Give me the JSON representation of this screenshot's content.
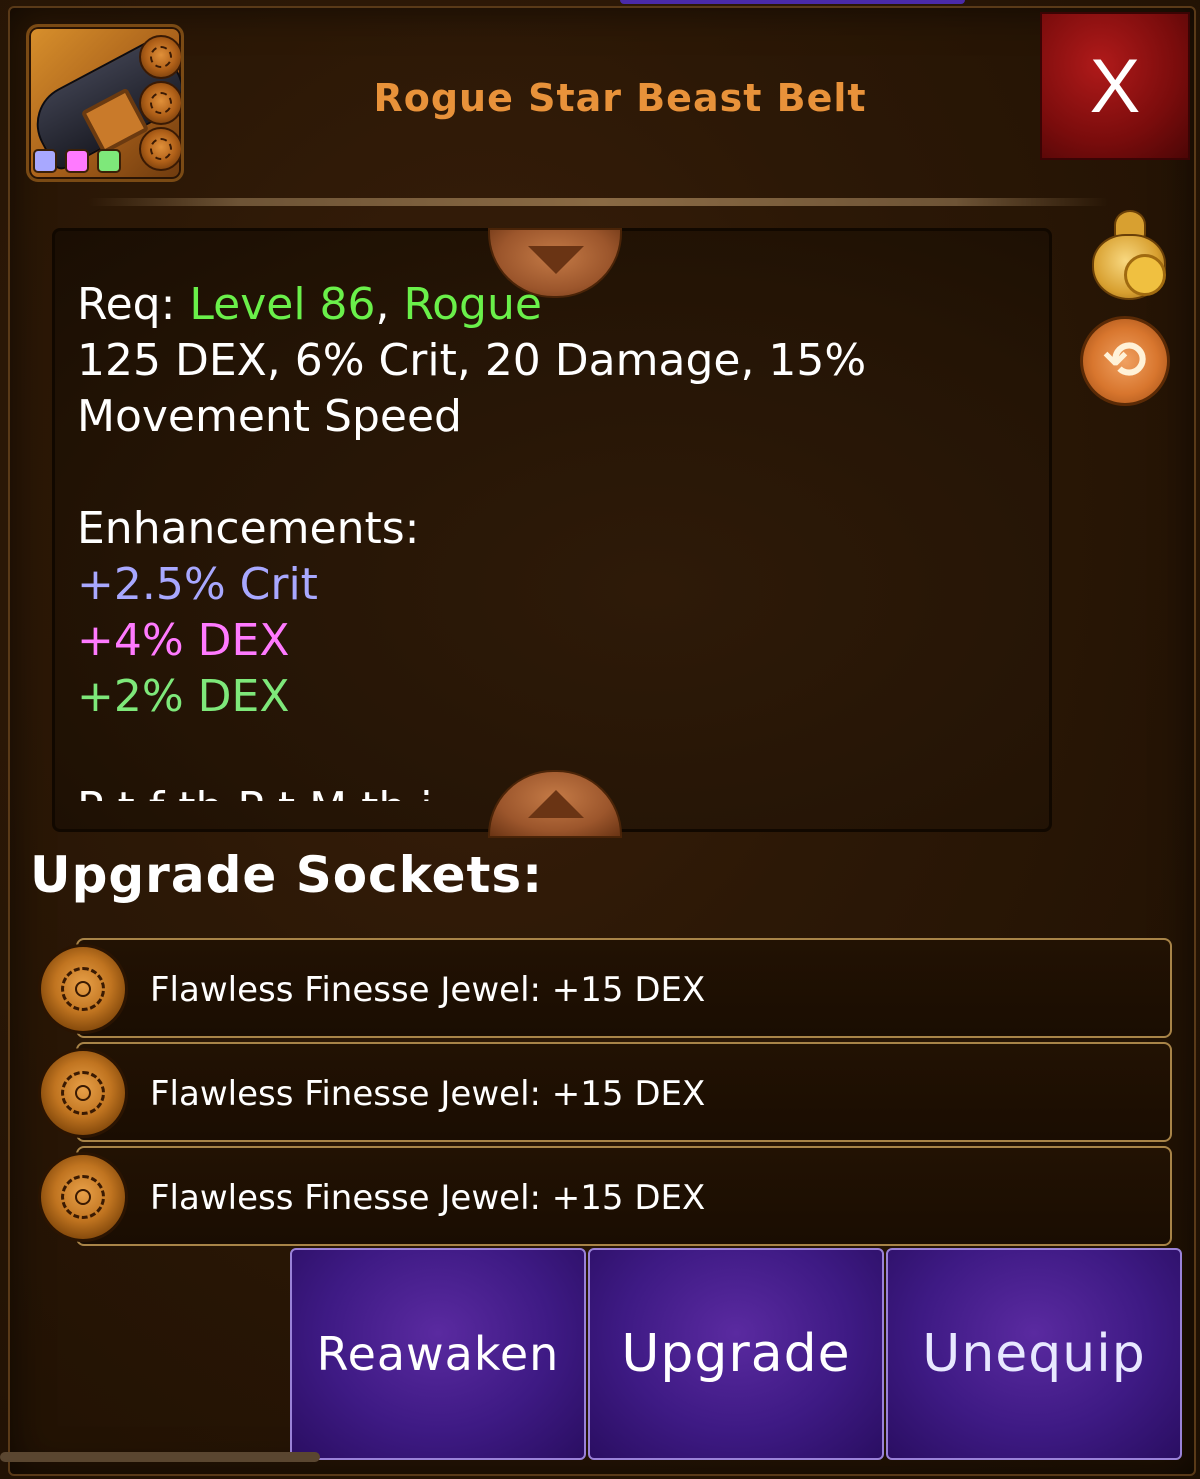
{
  "item": {
    "title": "Rogue Star Beast Belt",
    "gem_colors": [
      "#a8a8ff",
      "#ff7aff",
      "#7ee87a"
    ]
  },
  "close_label": "X",
  "description": {
    "req_label": "Req: ",
    "req_level": "Level 86",
    "req_sep": ", ",
    "req_class": "Rogue",
    "stats_line1": "125 DEX, 6% Crit, 20 Damage, 15%",
    "stats_line2": "Movement Speed",
    "enhancements_heading": "Enhancements:",
    "enh1": "+2.5% Crit",
    "enh2": "+4% DEX",
    "enh3": "+2% DEX",
    "cut_text": "P t f th P t M th i"
  },
  "sockets": {
    "heading": "Upgrade Sockets:",
    "items": [
      {
        "label": "Flawless Finesse Jewel: +15 DEX"
      },
      {
        "label": "Flawless Finesse Jewel: +15 DEX"
      },
      {
        "label": "Flawless Finesse Jewel: +15 DEX"
      }
    ]
  },
  "actions": {
    "reawaken": "Reawaken",
    "upgrade": "Upgrade",
    "unequip": "Unequip"
  },
  "icons": {
    "sell": "coin-bag-icon",
    "swap": "swap-arrows-icon",
    "swap_glyph": "⟲"
  }
}
